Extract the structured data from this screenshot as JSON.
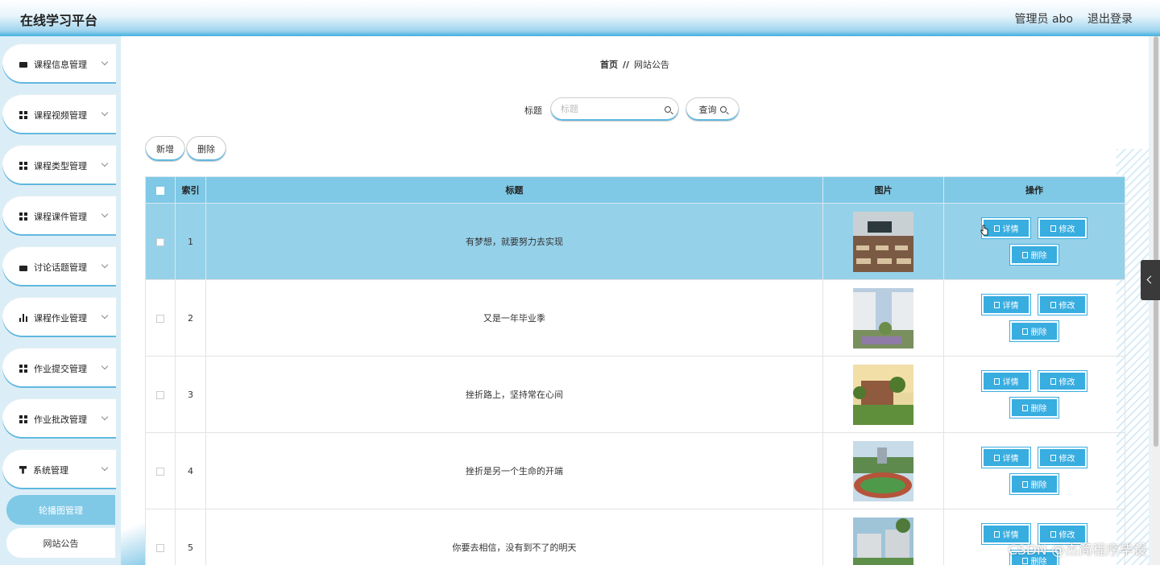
{
  "header": {
    "title": "在线学习平台",
    "user_label": "管理员 abo",
    "logout_label": "退出登录"
  },
  "sidebar": {
    "items": [
      {
        "label": "课程信息管理",
        "icon": "message-icon"
      },
      {
        "label": "课程视频管理",
        "icon": "grid-icon"
      },
      {
        "label": "课程类型管理",
        "icon": "grid-icon"
      },
      {
        "label": "课程课件管理",
        "icon": "grid-icon"
      },
      {
        "label": "讨论话题管理",
        "icon": "briefcase-icon"
      },
      {
        "label": "课程作业管理",
        "icon": "bar-chart-icon"
      },
      {
        "label": "作业提交管理",
        "icon": "grid-icon"
      },
      {
        "label": "作业批改管理",
        "icon": "grid-icon"
      },
      {
        "label": "系统管理",
        "icon": "funnel-icon"
      }
    ],
    "subitems": [
      {
        "label": "轮播图管理",
        "active": true
      },
      {
        "label": "网站公告",
        "active": false
      }
    ]
  },
  "breadcrumb": {
    "home": "首页",
    "separator": "//",
    "current": "网站公告"
  },
  "search": {
    "label": "标题",
    "placeholder": "标题",
    "button_label": "查询"
  },
  "actions": {
    "add_label": "新增",
    "delete_label": "删除"
  },
  "table": {
    "headers": {
      "index": "索引",
      "title": "标题",
      "image": "图片",
      "operations": "操作"
    },
    "ops": {
      "detail": "详情",
      "edit": "修改",
      "delete": "删除"
    },
    "rows": [
      {
        "index": "1",
        "title": "有梦想，就要努力去实现"
      },
      {
        "index": "2",
        "title": "又是一年毕业季"
      },
      {
        "index": "3",
        "title": "挫折路上，坚持常在心间"
      },
      {
        "index": "4",
        "title": "挫折是另一个生命的开端"
      },
      {
        "index": "5",
        "title": "你要去相信，没有到不了的明天"
      }
    ]
  },
  "watermark": "CSDN @杰简程序毕设",
  "colors": {
    "accent": "#38ade0",
    "header_row": "#7fc9e6",
    "highlight_row": "#96d1ea"
  }
}
